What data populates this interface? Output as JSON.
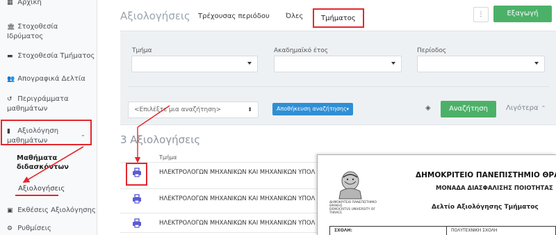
{
  "sidebar": {
    "items": [
      {
        "label": "Αρχική",
        "icon": "home-icon",
        "glyph": "▦"
      },
      {
        "label": "Στοχοθεσία Ιδρύματος",
        "icon": "institution-icon",
        "glyph": "🏛"
      },
      {
        "label": "Στοχοθεσία Τμήματος",
        "icon": "book-icon",
        "glyph": "▬"
      },
      {
        "label": "Απογραφικά Δελτία",
        "icon": "users-icon",
        "glyph": "👥"
      },
      {
        "label": "Περιγράμματα μαθημάτων",
        "icon": "history-icon",
        "glyph": "↺"
      },
      {
        "label": "Αξιολόγηση μαθημάτων",
        "icon": "document-icon",
        "glyph": "▮"
      },
      {
        "label": "Εκθέσεις Αξιολόγησης",
        "icon": "report-icon",
        "glyph": "▣"
      },
      {
        "label": "Ρυθμίσεις",
        "icon": "gear-icon",
        "glyph": "⚙"
      }
    ],
    "submenu": {
      "taught_courses": "Μαθήματα διδασκόντων",
      "evaluations": "Αξιολογήσεις"
    }
  },
  "header": {
    "title": "Αξιολογήσεις",
    "tabs": [
      "Τρέχουσας περιόδου",
      "Όλες",
      "Τμήματος"
    ],
    "active_tab": "Τμήματος",
    "more_glyph": "⋮",
    "export_label": "Εξαγωγή"
  },
  "filters": {
    "department_label": "Τμήμα",
    "year_label": "Ακαδημαϊκό έτος",
    "period_label": "Περίοδος",
    "search_placeholder": "<Επιλέξτε μια αναζήτηση>",
    "save_search_label": "Αποθήκευση αναζήτησης",
    "search_button": "Αναζήτηση",
    "less_link": "Λιγότερα"
  },
  "results": {
    "count_label": "3 Αξιολογήσεις",
    "column_header": "Τμήμα",
    "rows": [
      {
        "department": "ΗΛΕΚΤΡΟΛΟΓΩΝ ΜΗΧΑΝΙΚΩΝ ΚΑΙ ΜΗΧΑΝΙΚΩΝ ΥΠΟΛ"
      },
      {
        "department": "ΗΛΕΚΤΡΟΛΟΓΩΝ ΜΗΧΑΝΙΚΩΝ ΚΑΙ ΜΗΧΑΝΙΚΩΝ ΥΠΟΛ"
      },
      {
        "department": "ΗΛΕΚΤΡΟΛΟΓΩΝ ΜΗΧΑΝΙΚΩΝ ΚΑΙ ΜΗΧΑΝΙΚΩΝ ΥΠΟΛ"
      }
    ]
  },
  "document": {
    "university": "ΔΗΜΟΚΡΙΤΕΙΟ ΠΑΝΕΠΙΣΤΗΜΙΟ ΘΡΑ",
    "unit": "ΜΟΝΑΔΑ ΔΙΑΣΦΑΛΙΣΗΣ ΠΟΙΟΤΗΤΑΣ",
    "report_title": "Δελτίο Αξιολόγησης Τμήματος",
    "logo_text_greek": "ΔΗΜΟΚΡΙΤΕΙΟ ΠΑΝΕΠΙΣΤΗΜΙΟ ΘΡΑΚΗΣ",
    "logo_text_english": "DEMOCRITUS UNIVERSITY OF THRACE",
    "school_label": "ΣΧΟΛΗ:",
    "school_value": "ΠΟΛΥΤΕΧΝΙΚΗ ΣΧΟΛΗ"
  },
  "colors": {
    "accent_green": "#4cb168",
    "accent_blue": "#2f8fd5",
    "annotation_red": "#e3272d",
    "print_icon": "#5b5bd6"
  }
}
